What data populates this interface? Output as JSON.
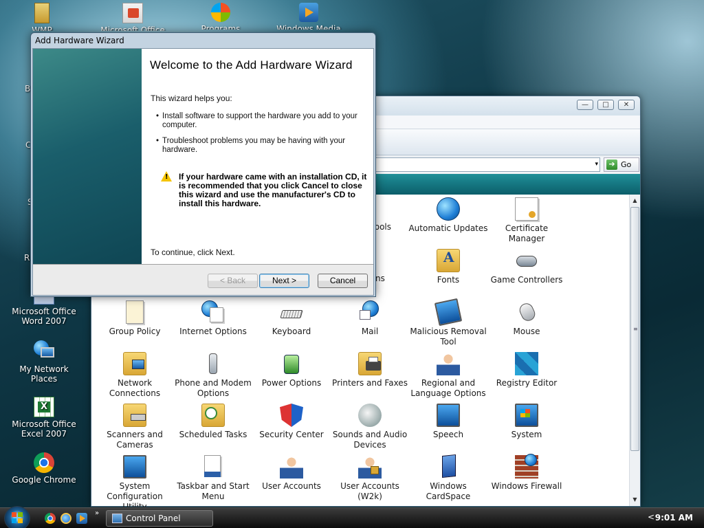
{
  "desktop": {
    "top_icons": [
      {
        "label": "WMP"
      },
      {
        "label": "Microsoft Office"
      },
      {
        "label": "Programs"
      },
      {
        "label": "Windows Media Player"
      }
    ],
    "left_partial": [
      "B",
      "C",
      "S",
      "R"
    ],
    "icons": [
      {
        "label": "Microsoft Office Word 2007"
      },
      {
        "label": "My Network Places"
      },
      {
        "label": "Microsoft Office Excel 2007"
      },
      {
        "label": "Google Chrome"
      }
    ]
  },
  "control_panel": {
    "window_buttons": {
      "minimize": "—",
      "maximize": "□",
      "close": "✕"
    },
    "address": {
      "dropdown": "▾",
      "go_label": "Go",
      "go_arrow": "➔"
    },
    "partial_items": [
      {
        "label": "ive Tools"
      },
      {
        "label": "ptions"
      }
    ],
    "items": [
      {
        "label": "Automatic Updates",
        "icon": "automatic-updates-icon"
      },
      {
        "label": "Certificate Manager",
        "icon": "certificate-icon"
      },
      {
        "label": "Fonts",
        "icon": "fonts-folder-icon"
      },
      {
        "label": "Game Controllers",
        "icon": "gamepad-icon"
      },
      {
        "label": "Group Policy",
        "icon": "group-policy-icon"
      },
      {
        "label": "Internet Options",
        "icon": "internet-options-icon"
      },
      {
        "label": "Keyboard",
        "icon": "keyboard-icon"
      },
      {
        "label": "Mail",
        "icon": "mail-icon"
      },
      {
        "label": "Malicious Removal Tool",
        "icon": "malicious-removal-icon"
      },
      {
        "label": "Mouse",
        "icon": "mouse-icon"
      },
      {
        "label": "Network Connections",
        "icon": "network-connections-icon"
      },
      {
        "label": "Phone and Modem Options",
        "icon": "phone-icon"
      },
      {
        "label": "Power Options",
        "icon": "power-icon"
      },
      {
        "label": "Printers and Faxes",
        "icon": "printer-icon"
      },
      {
        "label": "Regional and Language Options",
        "icon": "regional-icon"
      },
      {
        "label": "Registry Editor",
        "icon": "registry-icon"
      },
      {
        "label": "Scanners and Cameras",
        "icon": "scanner-icon"
      },
      {
        "label": "Scheduled Tasks",
        "icon": "scheduled-tasks-icon"
      },
      {
        "label": "Security Center",
        "icon": "shield-icon"
      },
      {
        "label": "Sounds and Audio Devices",
        "icon": "speaker-icon"
      },
      {
        "label": "Speech",
        "icon": "speech-icon"
      },
      {
        "label": "System",
        "icon": "system-icon"
      },
      {
        "label": "System Configuration Utility",
        "icon": "msconfig-icon"
      },
      {
        "label": "Taskbar and Start Menu",
        "icon": "taskbar-icon"
      },
      {
        "label": "User Accounts",
        "icon": "users-icon"
      },
      {
        "label": "User Accounts (W2k)",
        "icon": "users-lock-icon"
      },
      {
        "label": "Windows CardSpace",
        "icon": "cardspace-icon"
      },
      {
        "label": "Windows Firewall",
        "icon": "firewall-icon"
      }
    ],
    "scrollbar": {
      "up": "▲",
      "down": "▼",
      "grip": "≡"
    }
  },
  "wizard": {
    "title": "Add Hardware Wizard",
    "heading": "Welcome to the Add Hardware Wizard",
    "intro": "This wizard helps you:",
    "bullets": [
      "Install software to support the hardware you add to your computer.",
      "Troubleshoot problems you may be having with your hardware."
    ],
    "warning_mark": "!",
    "warning": "If your hardware came with an installation CD, it is recommended that you click Cancel to close this wizard and use the manufacturer's CD to install this hardware.",
    "continue_text": "To continue, click Next.",
    "buttons": {
      "back": "< Back",
      "next": "Next >",
      "cancel": "Cancel"
    }
  },
  "taskbar": {
    "more": "»",
    "task_label": "Control Panel",
    "tray_arrow": "<",
    "clock": "9:01 AM"
  }
}
